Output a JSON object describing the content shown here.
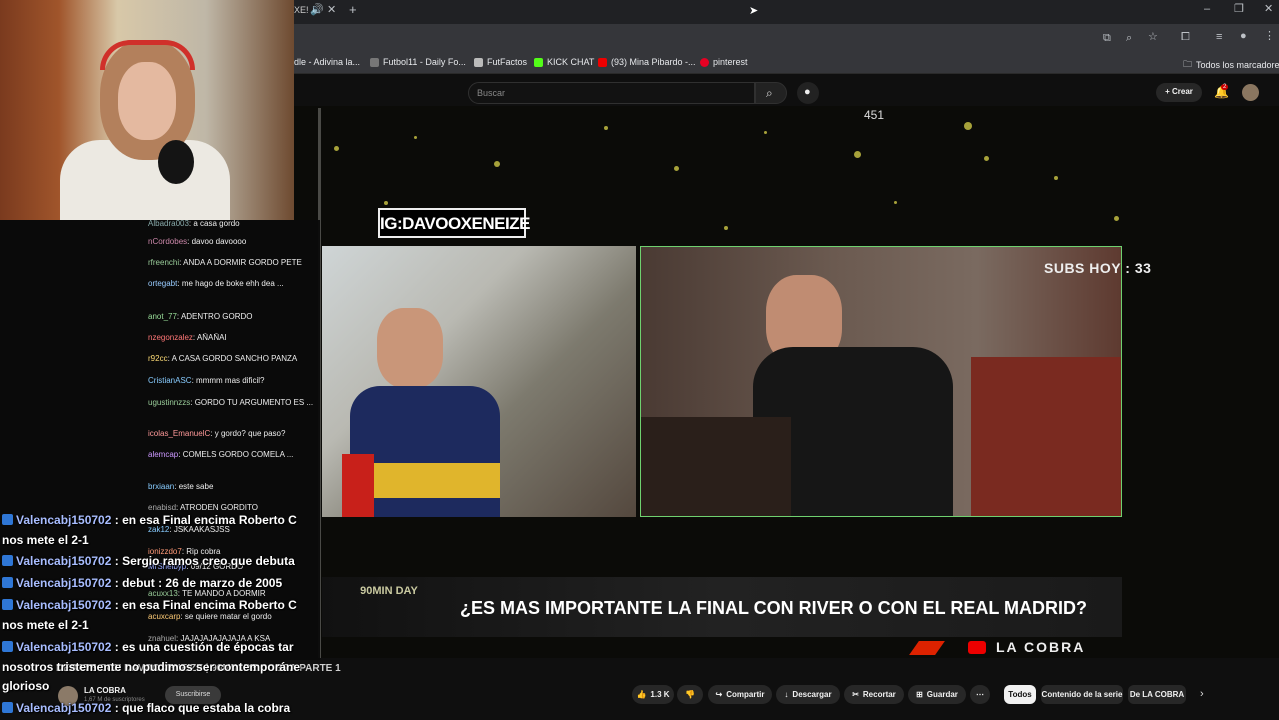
{
  "browser": {
    "bookmarks": [
      {
        "label": "dle - Adivina la...",
        "color": "#5b8"
      },
      {
        "label": "Futbol11 - Daily Fo...",
        "color": "#888"
      },
      {
        "label": "FutFactos",
        "color": "#bbb"
      },
      {
        "label": "KICK CHAT",
        "color": "#53fc18"
      },
      {
        "label": "(93) Mina Pibardo -...",
        "color": "#e00"
      },
      {
        "label": "pinterest",
        "color": "#e60023"
      }
    ],
    "all_bookmarks": "Todos los marcadores"
  },
  "youtube": {
    "search_placeholder": "Buscar",
    "create_label": "Crear",
    "notif_count": "2"
  },
  "video": {
    "viewer_count": "451",
    "ig_handle": "IG:DAVOOXENEIZE",
    "subs_today": "SUBS HOY : 33",
    "question": "¿ES MAS IMPORTANTE LA FINAL CON RIVER O CON EL REAL MADRID?",
    "brand": "90MIN DAY",
    "channel_watermark": "LA COBRA"
  },
  "below_video": {
    "title": "DEBATE CON DAVOOXENEIZE | 90MIN DE COBRA PARTE 1",
    "channel": "LA COBRA",
    "subs": "1,67 M de suscriptores",
    "subscribe": "Suscribirse",
    "likes": "1.3 K",
    "share": "Compartir",
    "download": "Descargar",
    "clip": "Recortar",
    "save": "Guardar",
    "chips": [
      "Todos",
      "Contenido de la serie",
      "De LA COBRA"
    ]
  },
  "chat_small": [
    {
      "user": "Albadra003",
      "color": "#8aa",
      "text": "a casa gordo"
    },
    {
      "user": "nCordobes",
      "color": "#c8a",
      "text": "davoo davoooo"
    },
    {
      "user": "rfreenchi",
      "color": "#9c9",
      "text": "ANDA A DORMIR GORDO PETE"
    },
    {
      "user": "ortegabt",
      "color": "#9cf",
      "text": "me hago de boke ehh dea ..."
    },
    {
      "user": "anot_77",
      "color": "#9d9",
      "text": "ADENTRO GORDO"
    },
    {
      "user": "nzegonzalez",
      "color": "#f77",
      "text": "AÑAÑAI"
    },
    {
      "user": "r92cc",
      "color": "#fd7",
      "text": "A CASA GORDO SANCHO PANZA"
    },
    {
      "user": "CristianASC",
      "color": "#8cf",
      "text": "mmmm mas dificil?"
    },
    {
      "user": "ugustinnzzs",
      "color": "#9c9",
      "text": "GORDO TU ARGUMENTO ES ..."
    },
    {
      "user": "icolas_EmanuelC",
      "color": "#f99",
      "text": "y gordo? que paso?"
    },
    {
      "user": "alemcap",
      "color": "#c9f",
      "text": "COMELS GORDO COMELA ..."
    },
    {
      "user": "brxiaan",
      "color": "#8cf",
      "text": "este sabe"
    },
    {
      "user": "enabisd",
      "color": "#aaa",
      "text": "ATRODEN GORDITO"
    },
    {
      "user": "zak12",
      "color": "#8cf",
      "text": "JSKAAKASJSS"
    },
    {
      "user": "ionizzdo7",
      "color": "#f97",
      "text": "Rip cobra"
    },
    {
      "user": "MrShelbyp",
      "color": "#9af",
      "text": "09/12 GORDO"
    },
    {
      "user": "acuxx13",
      "color": "#9c9",
      "text": "TE MANDO A DORMIR"
    },
    {
      "user": "acuxcarp",
      "color": "#fc7",
      "text": "se quiere matar el gordo"
    },
    {
      "user": "znahuel",
      "color": "#aaa",
      "text": "JAJAJAJAJAJAJA A KSA"
    }
  ],
  "chat_big": [
    {
      "user": "Valencabj150702",
      "text": "en esa Final encima Roberto C"
    },
    {
      "user": "",
      "text": "nos mete el 2-1"
    },
    {
      "user": "Valencabj150702",
      "text": "Sergio ramos creo que debuta"
    },
    {
      "user": "Valencabj150702",
      "text": "debut : 26 de marzo de 2005"
    },
    {
      "user": "Valencabj150702",
      "text": "en esa Final encima Roberto C"
    },
    {
      "user": "",
      "text": "nos mete el 2-1"
    },
    {
      "user": "Valencabj150702",
      "text": "es una cuestión de épocas tar"
    },
    {
      "user": "",
      "text": "nosotros tristemente no pudimos ser contemporáne"
    },
    {
      "user": "",
      "text": "glorioso"
    },
    {
      "user": "Valencabj150702",
      "text": "que flaco que estaba la cobra"
    }
  ]
}
